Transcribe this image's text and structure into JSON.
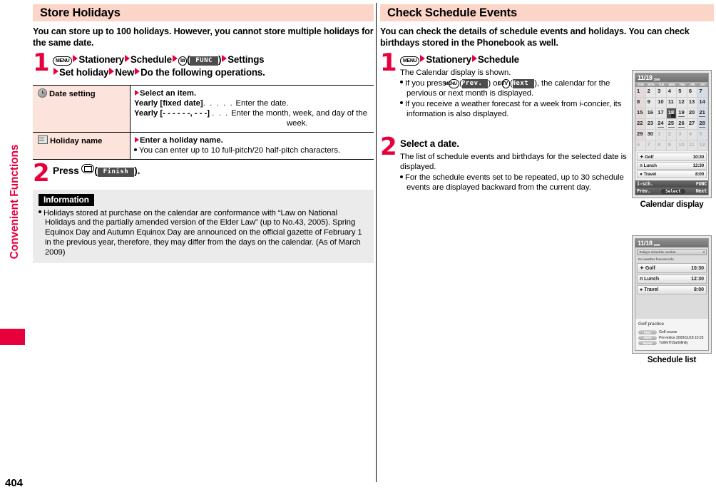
{
  "sidebar": {
    "tab_label": "Convenient Functions"
  },
  "page_number": "404",
  "left": {
    "heading": "Store Holidays",
    "intro": "You can store up to 100 holidays. However, you cannot store multiple holidays for the same date.",
    "step1": {
      "number": "1",
      "key_menu": "MENU",
      "item1": "Stationery",
      "item2": "Schedule",
      "key_ifunc": "iα",
      "softkey_func": "FUNC",
      "item3": "Settings",
      "item4": "Set holiday",
      "item5": "New",
      "item6": "Do the following operations."
    },
    "table": {
      "rows": [
        {
          "icon": "clock-icon",
          "label": "Date setting",
          "lead": "Select an item.",
          "lines": [
            {
              "term": "Yearly [fixed date]",
              "dots": ". . . . .",
              "desc": "Enter the date."
            },
            {
              "term": "Yearly [- - - - - -, - - -]",
              "dots": ". . .",
              "desc": "Enter the month, week, and day of the"
            },
            {
              "term": "",
              "dots": "",
              "desc": "week."
            }
          ]
        },
        {
          "icon": "note-icon",
          "label": "Holiday name",
          "lead": "Enter a holiday name.",
          "bullet": "You can enter up to 10 full-pitch/20 half-pitch characters."
        }
      ]
    },
    "step2": {
      "number": "2",
      "press_label": "Press",
      "key_mail": "mail-key",
      "softkey_finish": "Finish",
      "period": "."
    },
    "information": {
      "title": "Information",
      "body": "Holidays stored at purchase on the calendar are conformance with “Law on National Holidays and the partially amended version of the Elder Law” (up to No.43, 2005). Spring Equinox Day and Autumn Equinox Day are announced on the official gazette of February 1 in the previous year, therefore, they may differ from the days on the calendar. (As of March 2009)"
    }
  },
  "right": {
    "heading": "Check Schedule Events",
    "intro": "You can check the details of schedule events and holidays. You can check birthdays stored in the Phonebook as well.",
    "step1": {
      "number": "1",
      "key_menu": "MENU",
      "item1": "Stationery",
      "item2": "Schedule",
      "desc": "The Calendar display is shown.",
      "bullet1_a": "If you press",
      "bullet1_key1": "MENU",
      "bullet1_sk1": "Prev.",
      "bullet1_or": "or",
      "bullet1_key2": "⊙TV",
      "bullet1_sk2": "Next",
      "bullet1_b": "), the calendar for the pervious or next month is displayed.",
      "bullet2": "If you receive a weather forecast for a week from i-concier, its information is also displayed."
    },
    "step2": {
      "number": "2",
      "title": "Select a date.",
      "desc": "The list of schedule events and birthdays for the selected date is displayed.",
      "bullet": "For the schedule events set to be repeated, up to 30 schedule events are displayed backward from the current day."
    },
    "figure1": {
      "caption": "Calendar display",
      "header_date": "11/18",
      "header_year": "2009",
      "dow": [
        "SUN",
        "MON",
        "TUE",
        "WED",
        "THU",
        "FRI",
        "SAT"
      ],
      "weeks": [
        [
          {
            "d": "1",
            "k": "sun"
          },
          {
            "d": "2"
          },
          {
            "d": "3"
          },
          {
            "d": "4"
          },
          {
            "d": "5"
          },
          {
            "d": "6"
          },
          {
            "d": "7",
            "k": "sat"
          }
        ],
        [
          {
            "d": "8",
            "k": "sun"
          },
          {
            "d": "9"
          },
          {
            "d": "10"
          },
          {
            "d": "11"
          },
          {
            "d": "12"
          },
          {
            "d": "13"
          },
          {
            "d": "14",
            "k": "sat"
          }
        ],
        [
          {
            "d": "15",
            "k": "sun"
          },
          {
            "d": "16"
          },
          {
            "d": "17"
          },
          {
            "d": "18",
            "k": "sel"
          },
          {
            "d": "19",
            "u": true
          },
          {
            "d": "20"
          },
          {
            "d": "21",
            "k": "sat",
            "u": true
          }
        ],
        [
          {
            "d": "22",
            "k": "sun"
          },
          {
            "d": "23"
          },
          {
            "d": "24",
            "u": true
          },
          {
            "d": "25",
            "u": true
          },
          {
            "d": "26",
            "u": true
          },
          {
            "d": "27"
          },
          {
            "d": "28",
            "k": "sat",
            "u": true
          }
        ],
        [
          {
            "d": "29",
            "k": "sun"
          },
          {
            "d": "30"
          },
          {
            "d": "1",
            "k": "out"
          },
          {
            "d": "2",
            "k": "out"
          },
          {
            "d": "3",
            "k": "out"
          },
          {
            "d": "4",
            "k": "out"
          },
          {
            "d": "5",
            "k": "out sat"
          }
        ],
        [
          {
            "d": "6",
            "k": "out"
          },
          {
            "d": "7",
            "k": "out"
          },
          {
            "d": "8",
            "k": "out"
          },
          {
            "d": "9",
            "k": "out"
          },
          {
            "d": "10",
            "k": "out"
          },
          {
            "d": "11",
            "k": "out"
          },
          {
            "d": "12",
            "k": "out sat"
          }
        ]
      ],
      "events": [
        {
          "icon": "✦",
          "name": "Golf",
          "time": "10:30"
        },
        {
          "icon": "ᴨ",
          "name": "Lunch",
          "time": "12:30"
        },
        {
          "icon": "●",
          "name": "Travel",
          "time": "8:00"
        }
      ],
      "softkeys": {
        "left_top": "i-sch.",
        "left_bottom": "Prev.",
        "center": "Select",
        "right_top": "FUNC",
        "right_bottom": "Next"
      }
    },
    "figure2": {
      "caption": "Schedule list",
      "header_date": "11/18",
      "header_year": "2009",
      "status_bar_left": "Today's schedule number",
      "status_bar_right": "3",
      "weather_note": "No weather forecast info",
      "events": [
        {
          "icon": "✦",
          "name": "Golf",
          "time": "10:30"
        },
        {
          "icon": "ᴨ",
          "name": "Lunch",
          "time": "12:30"
        },
        {
          "icon": "●",
          "name": "Travel",
          "time": "8:00"
        }
      ],
      "detail_title": "Golf practice",
      "detail_rows": [
        {
          "tag": "Place",
          "value": "Golf course"
        },
        {
          "tag": "Alarm",
          "value": "Pre-notice 2009/11/18 10:25"
        },
        {
          "tag": "Repeat",
          "value": "TuWeThSa/Infinity"
        }
      ]
    }
  }
}
